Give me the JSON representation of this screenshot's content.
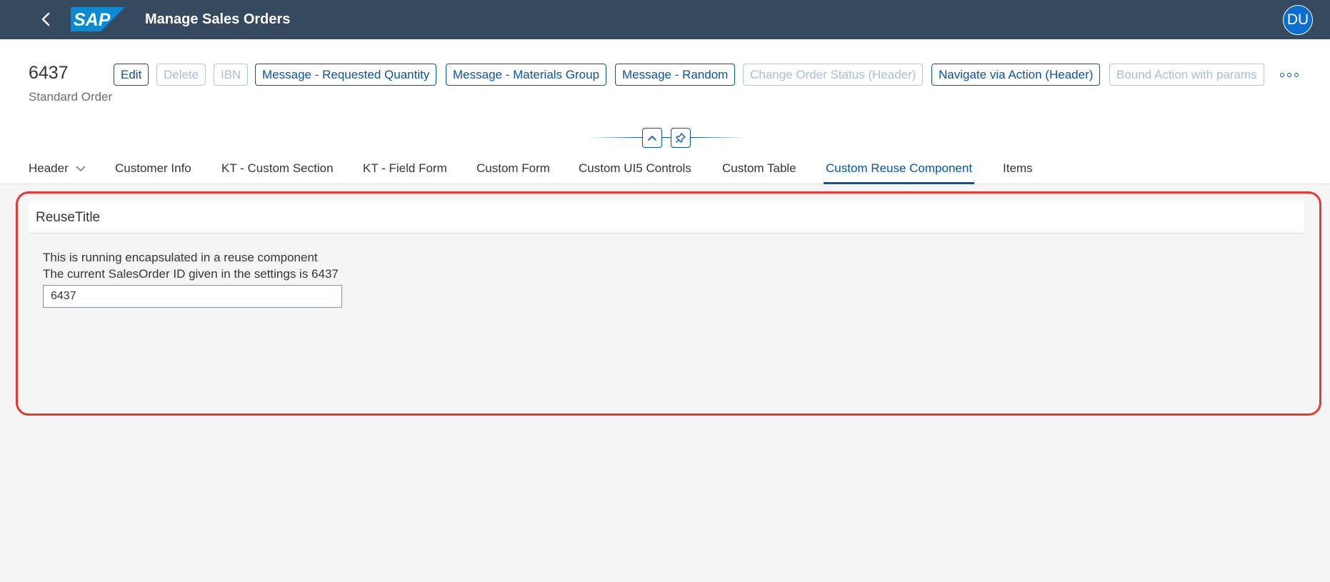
{
  "shell": {
    "title": "Manage Sales Orders",
    "logo_text": "SAP",
    "avatar_initials": "DU",
    "colors": {
      "shell_bg": "#354a5f",
      "avatar_bg": "#0a6ed1",
      "logo_blue": "#0a8ad2"
    }
  },
  "object_header": {
    "title": "6437",
    "subtitle": "Standard Order",
    "actions": [
      {
        "label": "Edit",
        "enabled": true
      },
      {
        "label": "Delete",
        "enabled": false
      },
      {
        "label": "IBN",
        "enabled": false
      },
      {
        "label": "Message - Requested Quantity",
        "enabled": true
      },
      {
        "label": "Message - Materials Group",
        "enabled": true
      },
      {
        "label": "Message - Random",
        "enabled": true
      },
      {
        "label": "Change Order Status (Header)",
        "enabled": false
      },
      {
        "label": "Navigate via Action (Header)",
        "enabled": true
      },
      {
        "label": "Bound Action with params",
        "enabled": false
      }
    ],
    "overflow_icon": "overflow-icon"
  },
  "tabs": [
    {
      "label": "Header",
      "has_menu": true,
      "selected": false
    },
    {
      "label": "Customer Info",
      "selected": false
    },
    {
      "label": "KT - Custom Section",
      "selected": false
    },
    {
      "label": "KT - Field Form",
      "selected": false
    },
    {
      "label": "Custom Form",
      "selected": false
    },
    {
      "label": "Custom UI5 Controls",
      "selected": false
    },
    {
      "label": "Custom Table",
      "selected": false
    },
    {
      "label": "Custom Reuse Component",
      "selected": true
    },
    {
      "label": "Items",
      "selected": false
    }
  ],
  "section": {
    "title": "ReuseTitle",
    "line1": "This is running encapsulated in a reuse component",
    "line2": "The current SalesOrder ID given in the settings is 6437",
    "input_value": "6437"
  },
  "colors": {
    "accent": "#0854a0",
    "highlight_border": "#e8382f"
  }
}
